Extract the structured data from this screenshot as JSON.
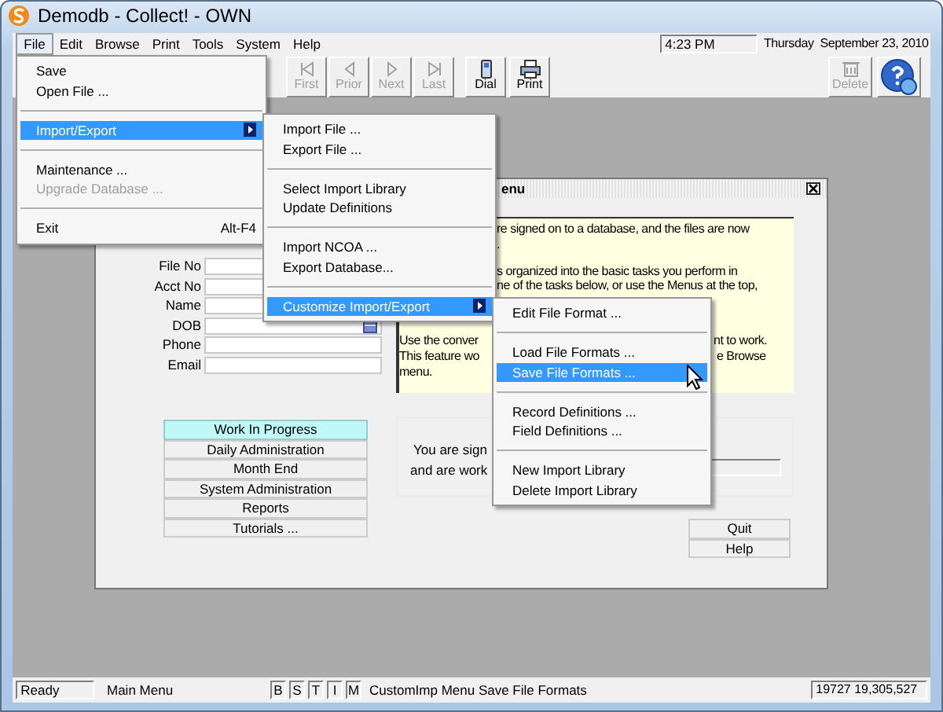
{
  "window": {
    "title": "Demodb - Collect! - OWN"
  },
  "menu_bar": [
    {
      "label": "File",
      "selected": true
    },
    {
      "label": "Edit",
      "selected": false
    },
    {
      "label": "Browse",
      "selected": false
    },
    {
      "label": "Print",
      "selected": false
    },
    {
      "label": "Tools",
      "selected": false
    },
    {
      "label": "System",
      "selected": false
    },
    {
      "label": "Help",
      "selected": false
    }
  ],
  "clock": {
    "time": "4:23 PM",
    "date": "Thursday  September 23, 2010"
  },
  "toolbar": [
    {
      "label": "First",
      "kind": "first",
      "disabled": true
    },
    {
      "label": "Prior",
      "kind": "prior",
      "disabled": true
    },
    {
      "label": "Next",
      "kind": "next",
      "disabled": true
    },
    {
      "label": "Last",
      "kind": "last",
      "disabled": true
    },
    {
      "label": "Dial",
      "kind": "phone",
      "disabled": false
    },
    {
      "label": "Print",
      "kind": "printer",
      "disabled": false
    }
  ],
  "toolbar_right": [
    {
      "label": "Delete",
      "kind": "trash",
      "disabled": true
    }
  ],
  "child_window": {
    "title": "enu",
    "form_fields": [
      {
        "label": "File No",
        "kind": "text"
      },
      {
        "label": "Acct No",
        "kind": "text"
      },
      {
        "label": "Name",
        "kind": "text"
      },
      {
        "label": "DOB",
        "kind": "date"
      },
      {
        "label": "Phone",
        "kind": "text"
      },
      {
        "label": "Email",
        "kind": "text"
      }
    ],
    "info_text": [
      "re signed on to a database, and the files are now",
      ".",
      "s organized into the basic tasks you perform in",
      "ne of the tasks below, or use the Menus at the top,",
      "Use the conver",
      "This feature wo",
      "menu.",
      "nt to work.",
      "e Browse"
    ],
    "task_buttons": [
      {
        "label": "Work In Progress",
        "selected": true
      },
      {
        "label": "Daily Administration",
        "selected": false
      },
      {
        "label": "Month End",
        "selected": false
      },
      {
        "label": "System Administration",
        "selected": false
      },
      {
        "label": "Reports",
        "selected": false
      },
      {
        "label": "Tutorials ...",
        "selected": false
      }
    ],
    "status_text": [
      "You are sign",
      "and are work"
    ],
    "buttons": [
      "Quit",
      "Help"
    ]
  },
  "file_menu": [
    {
      "kind": "item",
      "label": "Save",
      "selected": false,
      "disabled": false
    },
    {
      "kind": "item",
      "label": "Open File ...",
      "selected": false,
      "disabled": false
    },
    {
      "kind": "separator"
    },
    {
      "kind": "submenu",
      "label": "Import/Export",
      "selected": true,
      "disabled": false
    },
    {
      "kind": "separator"
    },
    {
      "kind": "item",
      "label": "Maintenance ...",
      "selected": false,
      "disabled": false
    },
    {
      "kind": "item",
      "label": "Upgrade Database ...",
      "selected": false,
      "disabled": true
    },
    {
      "kind": "separator"
    },
    {
      "kind": "item",
      "label": "Exit",
      "shortcut": "Alt-F4",
      "selected": false,
      "disabled": false
    }
  ],
  "import_export_menu": [
    {
      "kind": "item",
      "label": "Import File ...",
      "selected": false
    },
    {
      "kind": "item",
      "label": "Export File ...",
      "selected": false
    },
    {
      "kind": "separator"
    },
    {
      "kind": "item",
      "label": "Select Import Library",
      "selected": false
    },
    {
      "kind": "item",
      "label": "Update Definitions",
      "selected": false
    },
    {
      "kind": "separator"
    },
    {
      "kind": "item",
      "label": "Import NCOA ...",
      "selected": false
    },
    {
      "kind": "item",
      "label": "Export Database...",
      "selected": false
    },
    {
      "kind": "separator"
    },
    {
      "kind": "submenu",
      "label": "Customize Import/Export",
      "selected": true
    }
  ],
  "customize_menu": [
    {
      "kind": "item",
      "label": "Edit File Format ...",
      "selected": false
    },
    {
      "kind": "separator"
    },
    {
      "kind": "item",
      "label": "Load File Formats ...",
      "selected": false
    },
    {
      "kind": "item",
      "label": "Save File Formats ...",
      "selected": true
    },
    {
      "kind": "separator"
    },
    {
      "kind": "item",
      "label": "Record Definitions ...",
      "selected": false
    },
    {
      "kind": "item",
      "label": "Field Definitions ...",
      "selected": false
    },
    {
      "kind": "separator"
    },
    {
      "kind": "item",
      "label": "New Import Library",
      "selected": false
    },
    {
      "kind": "item",
      "label": "Delete Import Library",
      "selected": false
    }
  ],
  "status_bar": {
    "state": "Ready",
    "screen": "Main Menu",
    "flags": [
      "B",
      "S",
      "T",
      "I",
      "M"
    ],
    "message": "CustomImp Menu Save File Formats",
    "counts": "19727 19,305,527"
  }
}
